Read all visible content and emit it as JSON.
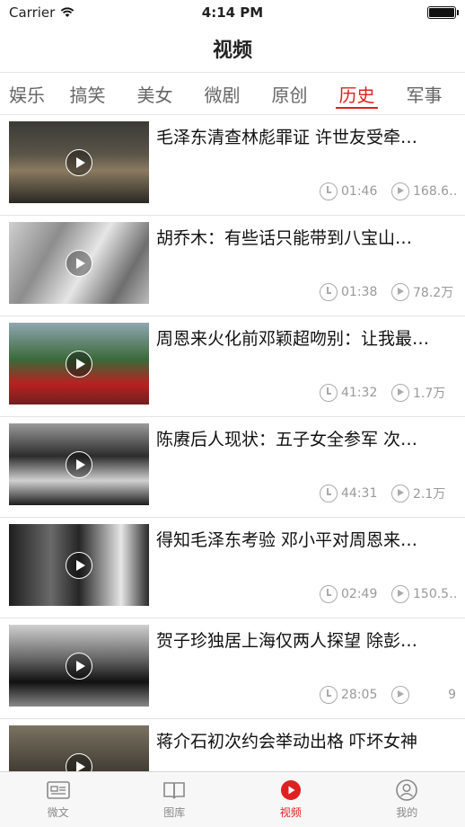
{
  "status_bar": {
    "carrier": "Carrier",
    "time": "4:14 PM",
    "battery_level": 1.0
  },
  "nav": {
    "title": "视频"
  },
  "tabs": [
    {
      "label": "娱乐",
      "active": false
    },
    {
      "label": "搞笑",
      "active": false
    },
    {
      "label": "美女",
      "active": false
    },
    {
      "label": "微剧",
      "active": false
    },
    {
      "label": "原创",
      "active": false
    },
    {
      "label": "历史",
      "active": true
    },
    {
      "label": "军事",
      "active": false
    }
  ],
  "videos": [
    {
      "title": "毛泽东清查林彪罪证 许世友受牵…",
      "duration": "01:46",
      "plays": "168.6…"
    },
    {
      "title": "胡乔木：有些话只能带到八宝山…",
      "duration": "01:38",
      "plays": "78.2万"
    },
    {
      "title": "周恩来火化前邓颖超吻别：让我最…",
      "duration": "41:32",
      "plays": "1.7万"
    },
    {
      "title": "陈赓后人现状：五子女全参军 次…",
      "duration": "44:31",
      "plays": "2.1万"
    },
    {
      "title": "得知毛泽东考验 邓小平对周恩来…",
      "duration": "02:49",
      "plays": "150.5…"
    },
    {
      "title": "贺子珍独居上海仅两人探望 除彭…",
      "duration": "28:05",
      "plays": "9"
    },
    {
      "title": "蒋介石初次约会举动出格 吓坏女神",
      "duration": "",
      "plays": ""
    }
  ],
  "tabbar": [
    {
      "label": "微文",
      "icon": "article-icon",
      "active": false
    },
    {
      "label": "图库",
      "icon": "book-icon",
      "active": false
    },
    {
      "label": "视频",
      "icon": "play-circle-icon",
      "active": true
    },
    {
      "label": "我的",
      "icon": "user-icon",
      "active": false
    }
  ],
  "colors": {
    "accent": "#e02020",
    "inactive": "#888888"
  }
}
